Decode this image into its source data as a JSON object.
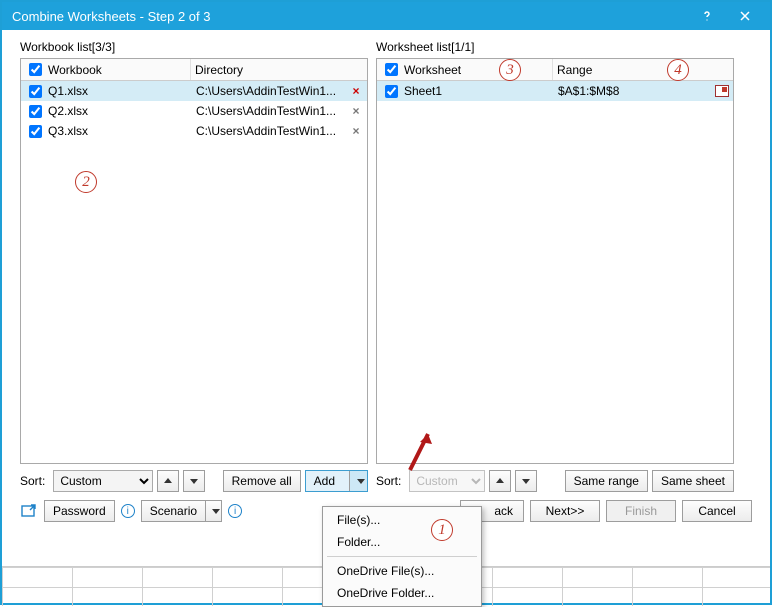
{
  "title": "Combine Worksheets - Step 2 of 3",
  "left": {
    "label": "Workbook list[3/3]",
    "col1": "Workbook",
    "col2": "Directory",
    "items": [
      {
        "name": "Q1.xlsx",
        "dir": "C:\\Users\\AddinTestWin1...",
        "sel": true
      },
      {
        "name": "Q2.xlsx",
        "dir": "C:\\Users\\AddinTestWin1...",
        "sel": false
      },
      {
        "name": "Q3.xlsx",
        "dir": "C:\\Users\\AddinTestWin1...",
        "sel": false
      }
    ]
  },
  "right": {
    "label": "Worksheet list[1/1]",
    "col1": "Worksheet",
    "col2": "Range",
    "items": [
      {
        "name": "Sheet1",
        "range": "$A$1:$M$8"
      }
    ]
  },
  "sort": {
    "label": "Sort:",
    "value": "Custom"
  },
  "buttons": {
    "remove_all": "Remove all",
    "add": "Add",
    "same_range": "Same range",
    "same_sheet": "Same sheet",
    "password": "Password",
    "scenario": "Scenario",
    "back": "ack",
    "next": "Next>>",
    "finish": "Finish",
    "cancel": "Cancel"
  },
  "menu": {
    "files": "File(s)...",
    "folder": "Folder...",
    "od_files": "OneDrive File(s)...",
    "od_folder": "OneDrive Folder..."
  },
  "markers": {
    "m1": "1",
    "m2": "2",
    "m3": "3",
    "m4": "4"
  },
  "icons": {
    "info": "i"
  }
}
